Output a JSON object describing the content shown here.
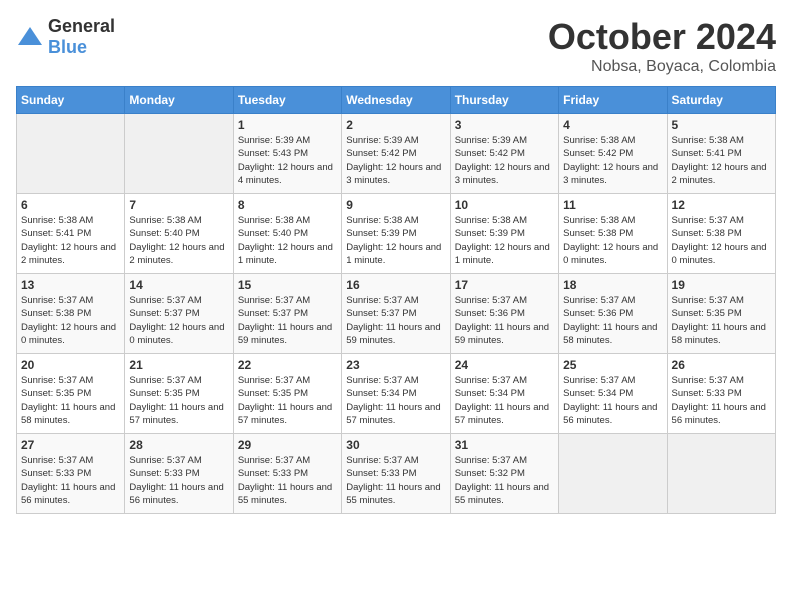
{
  "logo": {
    "general": "General",
    "blue": "Blue"
  },
  "title": "October 2024",
  "subtitle": "Nobsa, Boyaca, Colombia",
  "days_of_week": [
    "Sunday",
    "Monday",
    "Tuesday",
    "Wednesday",
    "Thursday",
    "Friday",
    "Saturday"
  ],
  "weeks": [
    [
      {
        "day": "",
        "empty": true
      },
      {
        "day": "",
        "empty": true
      },
      {
        "day": "1",
        "sunrise": "Sunrise: 5:39 AM",
        "sunset": "Sunset: 5:43 PM",
        "daylight": "Daylight: 12 hours and 4 minutes."
      },
      {
        "day": "2",
        "sunrise": "Sunrise: 5:39 AM",
        "sunset": "Sunset: 5:42 PM",
        "daylight": "Daylight: 12 hours and 3 minutes."
      },
      {
        "day": "3",
        "sunrise": "Sunrise: 5:39 AM",
        "sunset": "Sunset: 5:42 PM",
        "daylight": "Daylight: 12 hours and 3 minutes."
      },
      {
        "day": "4",
        "sunrise": "Sunrise: 5:38 AM",
        "sunset": "Sunset: 5:42 PM",
        "daylight": "Daylight: 12 hours and 3 minutes."
      },
      {
        "day": "5",
        "sunrise": "Sunrise: 5:38 AM",
        "sunset": "Sunset: 5:41 PM",
        "daylight": "Daylight: 12 hours and 2 minutes."
      }
    ],
    [
      {
        "day": "6",
        "sunrise": "Sunrise: 5:38 AM",
        "sunset": "Sunset: 5:41 PM",
        "daylight": "Daylight: 12 hours and 2 minutes."
      },
      {
        "day": "7",
        "sunrise": "Sunrise: 5:38 AM",
        "sunset": "Sunset: 5:40 PM",
        "daylight": "Daylight: 12 hours and 2 minutes."
      },
      {
        "day": "8",
        "sunrise": "Sunrise: 5:38 AM",
        "sunset": "Sunset: 5:40 PM",
        "daylight": "Daylight: 12 hours and 1 minute."
      },
      {
        "day": "9",
        "sunrise": "Sunrise: 5:38 AM",
        "sunset": "Sunset: 5:39 PM",
        "daylight": "Daylight: 12 hours and 1 minute."
      },
      {
        "day": "10",
        "sunrise": "Sunrise: 5:38 AM",
        "sunset": "Sunset: 5:39 PM",
        "daylight": "Daylight: 12 hours and 1 minute."
      },
      {
        "day": "11",
        "sunrise": "Sunrise: 5:38 AM",
        "sunset": "Sunset: 5:38 PM",
        "daylight": "Daylight: 12 hours and 0 minutes."
      },
      {
        "day": "12",
        "sunrise": "Sunrise: 5:37 AM",
        "sunset": "Sunset: 5:38 PM",
        "daylight": "Daylight: 12 hours and 0 minutes."
      }
    ],
    [
      {
        "day": "13",
        "sunrise": "Sunrise: 5:37 AM",
        "sunset": "Sunset: 5:38 PM",
        "daylight": "Daylight: 12 hours and 0 minutes."
      },
      {
        "day": "14",
        "sunrise": "Sunrise: 5:37 AM",
        "sunset": "Sunset: 5:37 PM",
        "daylight": "Daylight: 12 hours and 0 minutes."
      },
      {
        "day": "15",
        "sunrise": "Sunrise: 5:37 AM",
        "sunset": "Sunset: 5:37 PM",
        "daylight": "Daylight: 11 hours and 59 minutes."
      },
      {
        "day": "16",
        "sunrise": "Sunrise: 5:37 AM",
        "sunset": "Sunset: 5:37 PM",
        "daylight": "Daylight: 11 hours and 59 minutes."
      },
      {
        "day": "17",
        "sunrise": "Sunrise: 5:37 AM",
        "sunset": "Sunset: 5:36 PM",
        "daylight": "Daylight: 11 hours and 59 minutes."
      },
      {
        "day": "18",
        "sunrise": "Sunrise: 5:37 AM",
        "sunset": "Sunset: 5:36 PM",
        "daylight": "Daylight: 11 hours and 58 minutes."
      },
      {
        "day": "19",
        "sunrise": "Sunrise: 5:37 AM",
        "sunset": "Sunset: 5:35 PM",
        "daylight": "Daylight: 11 hours and 58 minutes."
      }
    ],
    [
      {
        "day": "20",
        "sunrise": "Sunrise: 5:37 AM",
        "sunset": "Sunset: 5:35 PM",
        "daylight": "Daylight: 11 hours and 58 minutes."
      },
      {
        "day": "21",
        "sunrise": "Sunrise: 5:37 AM",
        "sunset": "Sunset: 5:35 PM",
        "daylight": "Daylight: 11 hours and 57 minutes."
      },
      {
        "day": "22",
        "sunrise": "Sunrise: 5:37 AM",
        "sunset": "Sunset: 5:35 PM",
        "daylight": "Daylight: 11 hours and 57 minutes."
      },
      {
        "day": "23",
        "sunrise": "Sunrise: 5:37 AM",
        "sunset": "Sunset: 5:34 PM",
        "daylight": "Daylight: 11 hours and 57 minutes."
      },
      {
        "day": "24",
        "sunrise": "Sunrise: 5:37 AM",
        "sunset": "Sunset: 5:34 PM",
        "daylight": "Daylight: 11 hours and 57 minutes."
      },
      {
        "day": "25",
        "sunrise": "Sunrise: 5:37 AM",
        "sunset": "Sunset: 5:34 PM",
        "daylight": "Daylight: 11 hours and 56 minutes."
      },
      {
        "day": "26",
        "sunrise": "Sunrise: 5:37 AM",
        "sunset": "Sunset: 5:33 PM",
        "daylight": "Daylight: 11 hours and 56 minutes."
      }
    ],
    [
      {
        "day": "27",
        "sunrise": "Sunrise: 5:37 AM",
        "sunset": "Sunset: 5:33 PM",
        "daylight": "Daylight: 11 hours and 56 minutes."
      },
      {
        "day": "28",
        "sunrise": "Sunrise: 5:37 AM",
        "sunset": "Sunset: 5:33 PM",
        "daylight": "Daylight: 11 hours and 56 minutes."
      },
      {
        "day": "29",
        "sunrise": "Sunrise: 5:37 AM",
        "sunset": "Sunset: 5:33 PM",
        "daylight": "Daylight: 11 hours and 55 minutes."
      },
      {
        "day": "30",
        "sunrise": "Sunrise: 5:37 AM",
        "sunset": "Sunset: 5:33 PM",
        "daylight": "Daylight: 11 hours and 55 minutes."
      },
      {
        "day": "31",
        "sunrise": "Sunrise: 5:37 AM",
        "sunset": "Sunset: 5:32 PM",
        "daylight": "Daylight: 11 hours and 55 minutes."
      },
      {
        "day": "",
        "empty": true
      },
      {
        "day": "",
        "empty": true
      }
    ]
  ]
}
